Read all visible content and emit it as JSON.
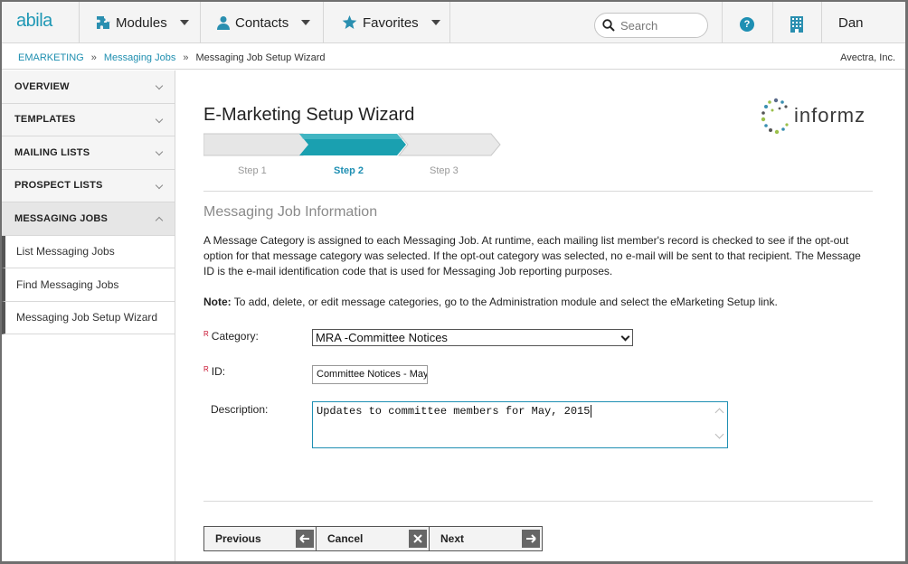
{
  "brand": {
    "logo_text": "abila"
  },
  "nav": {
    "modules_label": "Modules",
    "contacts_label": "Contacts",
    "favorites_label": "Favorites",
    "search_placeholder": "Search",
    "help_icon": "?",
    "user_name": "Dan"
  },
  "breadcrumb": {
    "items": [
      "EMARKETING",
      "Messaging Jobs",
      "Messaging Job Setup Wizard"
    ],
    "separator": "»",
    "org": "Avectra, Inc."
  },
  "sidebar": {
    "sections": [
      {
        "label": "OVERVIEW"
      },
      {
        "label": "TEMPLATES"
      },
      {
        "label": "MAILING LISTS"
      },
      {
        "label": "PROSPECT LISTS"
      },
      {
        "label": "MESSAGING JOBS"
      }
    ],
    "sub_items": [
      {
        "label": "List Messaging Jobs"
      },
      {
        "label": "Find Messaging Jobs"
      },
      {
        "label": "Messaging Job Setup Wizard"
      }
    ]
  },
  "wizard": {
    "title": "E-Marketing Setup Wizard",
    "partner_logo": "informz",
    "steps": [
      "Step 1",
      "Step 2",
      "Step 3"
    ],
    "active_step": 2,
    "section_title": "Messaging Job Information",
    "description": "A Message Category is assigned to each Messaging Job. At runtime, each mailing list member's record is checked to see if the opt-out option for that message category was selected. If the opt-out category was selected, no e-mail will be sent to that recipient. The Message ID is the e-mail identification code that is used for Messaging Job reporting purposes.",
    "note_label": "Note:",
    "note_text": " To add, delete, or edit message categories, go to the Administration module and select the eMarketing Setup link."
  },
  "form": {
    "required_marker": "R",
    "category_label": "Category:",
    "category_value": "MRA -Committee Notices",
    "id_label": "ID:",
    "id_value": "Committee Notices - May",
    "description_label": "Description:",
    "description_value": "Updates to committee members for May, 2015"
  },
  "buttons": {
    "previous": "Previous",
    "cancel": "Cancel",
    "next": "Next"
  },
  "colors": {
    "accent": "#1e8fb3",
    "step_active": "#1aa0b0"
  }
}
